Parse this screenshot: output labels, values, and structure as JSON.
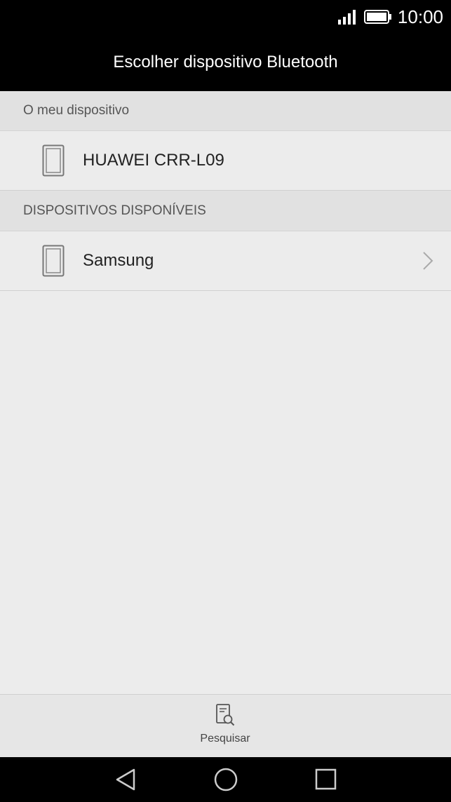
{
  "status_bar": {
    "time": "10:00",
    "icons": [
      "signal-icon",
      "battery-icon"
    ]
  },
  "header": {
    "title": "Escolher dispositivo Bluetooth"
  },
  "my_device": {
    "section_label": "O meu dispositivo",
    "device_name": "HUAWEI CRR-L09",
    "icon": "phone-icon"
  },
  "available_devices": {
    "section_label": "DISPOSITIVOS DISPONÍVEIS",
    "items": [
      {
        "name": "Samsung",
        "icon": "phone-icon"
      }
    ]
  },
  "bottom_bar": {
    "search_label": "Pesquisar",
    "icon": "search-device-icon"
  },
  "nav_bar": {
    "buttons": [
      "back-icon",
      "home-icon",
      "recents-icon"
    ]
  },
  "colors": {
    "header_bg": "#000000",
    "page_bg": "#ececec",
    "section_bg": "#e1e1e1"
  }
}
